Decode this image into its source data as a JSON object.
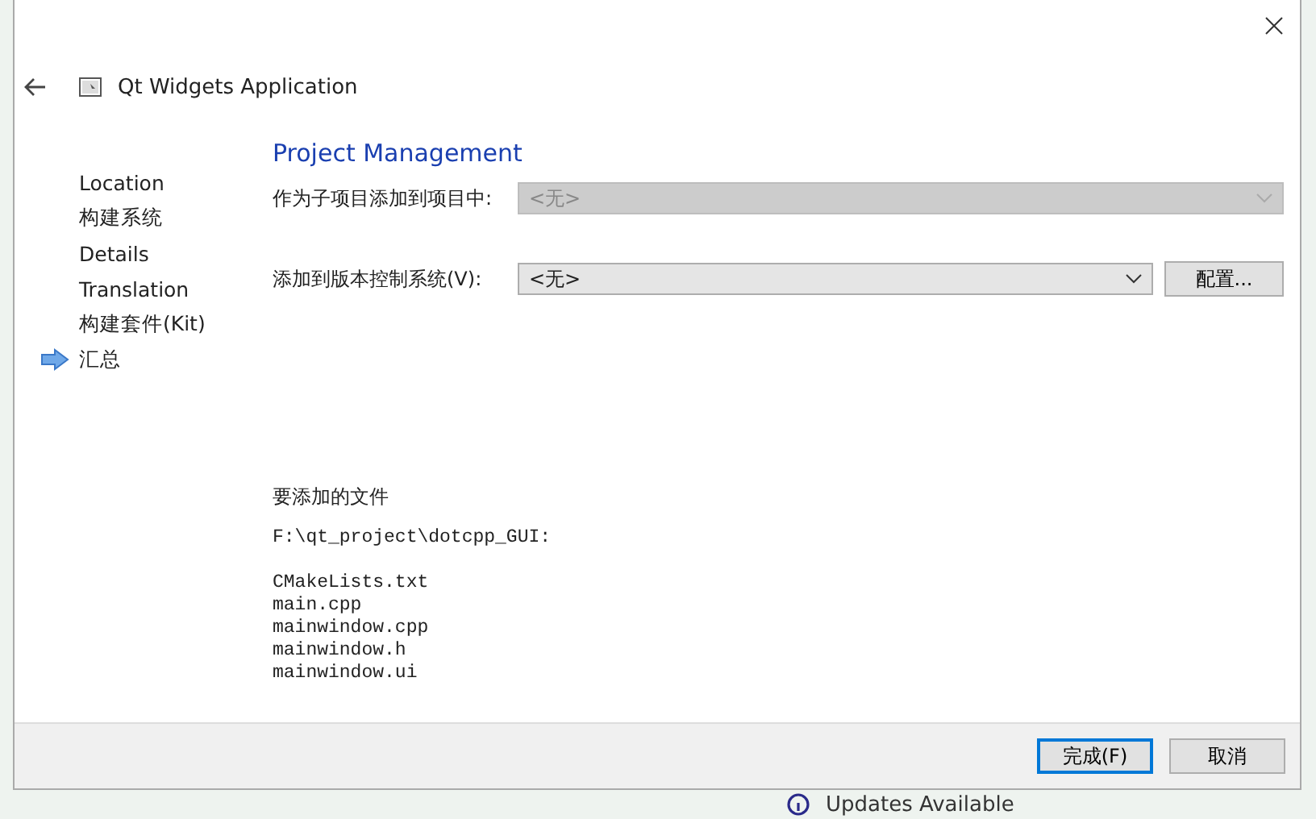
{
  "dialog": {
    "title": "Qt Widgets Application",
    "steps": [
      {
        "label": "Location",
        "selected": false
      },
      {
        "label": "构建系统",
        "selected": false
      },
      {
        "label": "Details",
        "selected": false
      },
      {
        "label": "Translation",
        "selected": false
      },
      {
        "label": "构建套件(Kit)",
        "selected": false
      },
      {
        "label": "汇总",
        "selected": true
      }
    ],
    "heading": "Project Management",
    "fields": [
      {
        "label": "作为子项目添加到项目中:",
        "value": "<无>",
        "disabled": true
      },
      {
        "label": "添加到版本控制系统(V):",
        "value": "<无>",
        "disabled": false,
        "button": "配置..."
      }
    ],
    "files_heading": "要添加的文件",
    "files_path": "F:\\qt_project\\dotcpp_GUI:",
    "files": [
      "CMakeLists.txt",
      "main.cpp",
      "mainwindow.cpp",
      "mainwindow.h",
      "mainwindow.ui"
    ],
    "buttons": [
      {
        "label": "完成(F)",
        "selected": true
      },
      {
        "label": "取消",
        "selected": false
      }
    ]
  },
  "backdrop": {
    "notice": "Updates Available"
  }
}
